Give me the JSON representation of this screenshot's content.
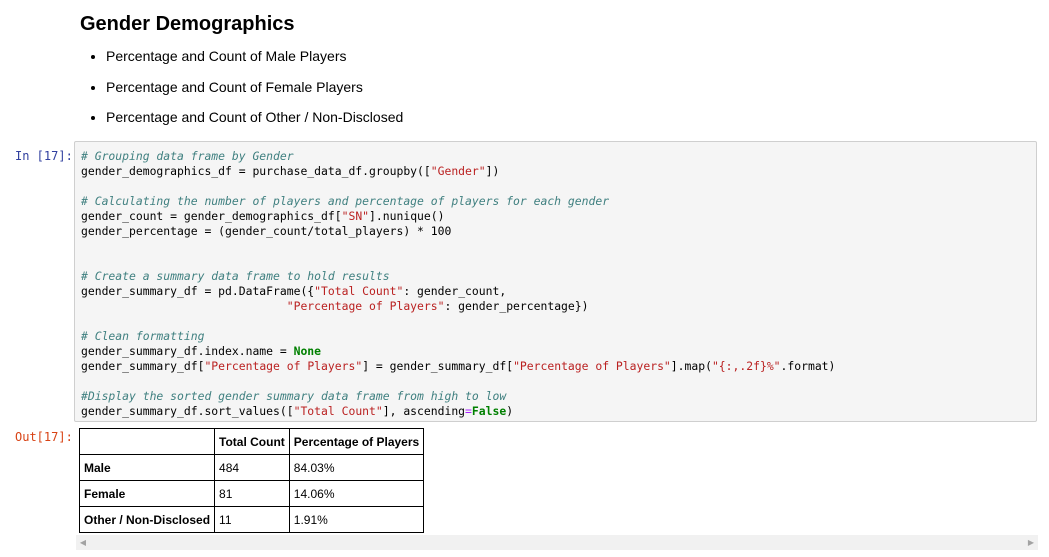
{
  "markdown": {
    "title": "Gender Demographics",
    "bullets": [
      "Percentage and Count of Male Players",
      "Percentage and Count of Female Players",
      "Percentage and Count of Other / Non-Disclosed"
    ]
  },
  "cell": {
    "in_prompt": "In [17]:",
    "out_prompt": "Out[17]:"
  },
  "code_lines": [
    "# Grouping data frame by Gender",
    "gender_demographics_df = purchase_data_df.groupby([\"Gender\"])",
    "",
    "# Calculating the number of players and percentage of players for each gender",
    "gender_count = gender_demographics_df[\"SN\"].nunique()",
    "gender_percentage = (gender_count/total_players) * 100",
    "",
    "",
    "# Create a summary data frame to hold results",
    "gender_summary_df = pd.DataFrame({\"Total Count\": gender_count,",
    "                              \"Percentage of Players\": gender_percentage})",
    "",
    "# Clean formatting",
    "gender_summary_df.index.name = None",
    "gender_summary_df[\"Percentage of Players\"] = gender_summary_df[\"Percentage of Players\"].map(\"{:,.2f}%\".format)",
    "",
    "#Display the sorted gender summary data frame from high to low",
    "gender_summary_df.sort_values([\"Total Count\"], ascending=False)"
  ],
  "output_table": {
    "columns": [
      "",
      "Total Count",
      "Percentage of Players"
    ],
    "rows": [
      {
        "index": "Male",
        "total_count": "484",
        "percentage": "84.03%"
      },
      {
        "index": "Female",
        "total_count": "81",
        "percentage": "14.06%"
      },
      {
        "index": "Other / Non-Disclosed",
        "total_count": "11",
        "percentage": "1.91%"
      }
    ]
  },
  "scrollbar": {
    "left_arrow": "◀",
    "right_arrow": "▶"
  }
}
